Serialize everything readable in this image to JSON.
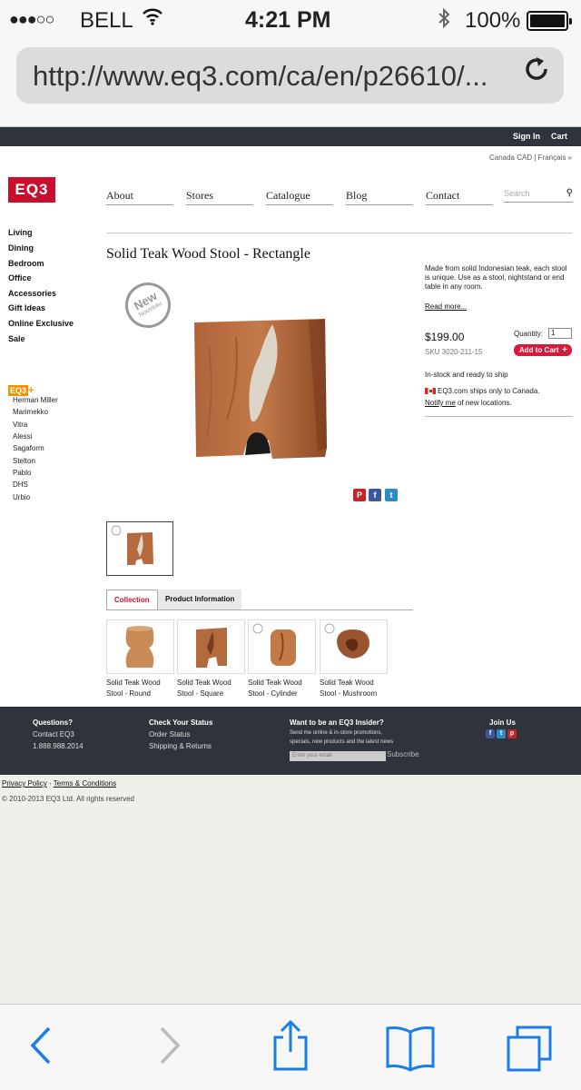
{
  "status_bar": {
    "signal": "●●●○○",
    "carrier": "BELL",
    "time": "4:21 PM",
    "battery": "100%"
  },
  "browser": {
    "url": "http://www.eq3.com/ca/en/p26610/..."
  },
  "topbar": {
    "sign_in": "Sign In",
    "cart": "Cart"
  },
  "locale": "Canada CAD | Français »",
  "logo": "EQ3",
  "nav": [
    "About",
    "Stores",
    "Catalogue",
    "Blog",
    "Contact"
  ],
  "search": {
    "placeholder": "Search"
  },
  "sidebar": {
    "categories": [
      "Living",
      "Dining",
      "Bedroom",
      "Office",
      "Accessories",
      "Gift Ideas",
      "Online Exclusive",
      "Sale"
    ],
    "eq3plus_label": "EQ3",
    "brands": [
      "Herman Miller",
      "Marimekko",
      "Vitra",
      "Alessi",
      "Sagaform",
      "Stelton",
      "Pablo",
      "DHS",
      "Urbio"
    ]
  },
  "product": {
    "title": "Solid Teak Wood Stool - Rectangle",
    "badge_new": "New",
    "badge_fr": "Nouveau",
    "description": "Made from solid Indonesian teak, each stool is unique. Use as a stool, nightstand or end table in any room.",
    "read_more": "Read more...",
    "price": "$199.00",
    "sku": "SKU 3020-211-15",
    "quantity_label": "Quantity:",
    "quantity": "1",
    "add_to_cart": "Add to Cart",
    "stock": "In-stock and ready to ship",
    "ships": "EQ3.com ships only to Canada.",
    "notify_link": "Notify me",
    "notify_rest": " of new locations."
  },
  "tabs": [
    "Collection",
    "Product Information"
  ],
  "collection": [
    {
      "line1": "Solid Teak Wood",
      "line2": "Stool - Round"
    },
    {
      "line1": "Solid Teak Wood",
      "line2": "Stool - Square"
    },
    {
      "line1": "Solid Teak Wood",
      "line2": "Stool - Cylinder"
    },
    {
      "line1": "Solid Teak Wood",
      "line2": "Stool - Mushroom"
    }
  ],
  "footer": {
    "questions": {
      "heading": "Questions?",
      "contact": "Contact EQ3",
      "phone": "1.888.988.2014"
    },
    "status": {
      "heading": "Check Your Status",
      "order": "Order Status",
      "shipping": "Shipping & Returns"
    },
    "insider": {
      "heading": "Want to be an EQ3 Insider?",
      "line1": "Send me online & in-store promotions,",
      "line2": "specials, new products and the latest news",
      "email_placeholder": "Enter your email",
      "subscribe": "Subscribe"
    },
    "join": {
      "heading": "Join Us"
    }
  },
  "legal": {
    "privacy": "Privacy Policy",
    "sep": " · ",
    "terms": "Terms & Conditions",
    "copyright": "© 2010-2013 EQ3 Ltd. All rights reserved"
  },
  "colors": {
    "brand_red": "#c8102e",
    "dark_bar": "#2f343c",
    "ios_blue": "#1a7ee8",
    "eq3plus_orange": "#f39200"
  }
}
